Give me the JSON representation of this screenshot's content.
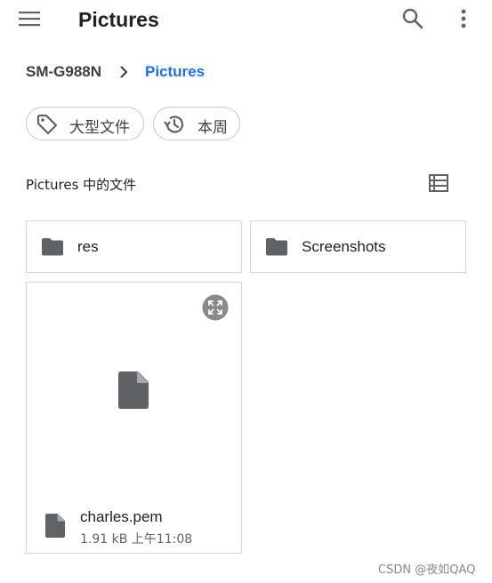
{
  "header": {
    "title": "Pictures",
    "menu_icon": "hamburger-menu-icon",
    "search_icon": "search-icon",
    "more_icon": "more-vert-icon"
  },
  "breadcrumb": {
    "root": "SM-G988N",
    "current": "Pictures",
    "separator_icon": "chevron-right-icon"
  },
  "filters": [
    {
      "label": "大型文件",
      "icon": "tag-icon"
    },
    {
      "label": "本周",
      "icon": "history-icon"
    }
  ],
  "section": {
    "title": "Pictures 中的文件",
    "view_toggle_icon": "list-view-icon"
  },
  "folders": [
    {
      "name": "res",
      "icon": "folder-icon"
    },
    {
      "name": "Screenshots",
      "icon": "folder-icon"
    }
  ],
  "files": [
    {
      "name": "charles.pem",
      "meta": "1.91 kB 上午11:08",
      "icon": "file-icon"
    }
  ],
  "watermark": "CSDN @夜如QAQ",
  "colors": {
    "accent": "#1a73e8",
    "icon": "#5f6368",
    "text": "#202124",
    "border": "#d5d5d5"
  }
}
